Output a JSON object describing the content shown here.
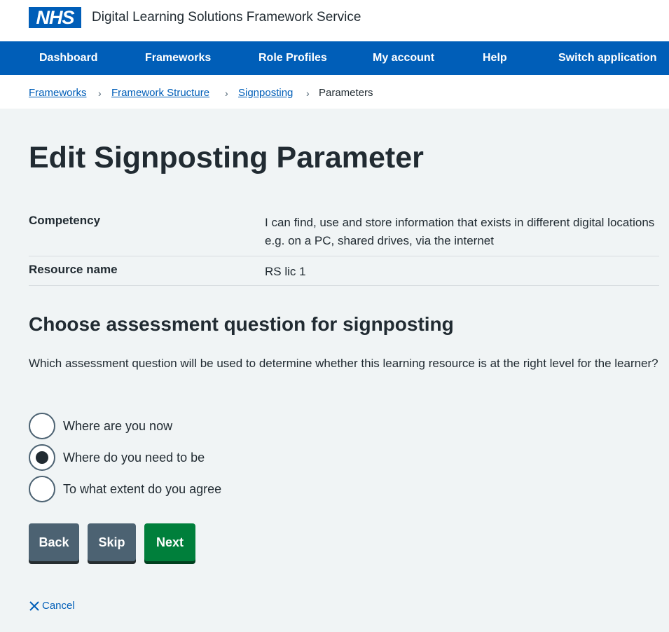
{
  "header": {
    "logo_text": "NHS",
    "service_name": "Digital Learning Solutions Framework Service"
  },
  "nav": {
    "items": [
      "Dashboard",
      "Frameworks",
      "Role Profiles",
      "My account",
      "Help",
      "Switch application"
    ]
  },
  "breadcrumb": {
    "links": [
      "Frameworks",
      "Framework Structure",
      "Signposting"
    ],
    "current": "Parameters"
  },
  "page": {
    "title": "Edit Signposting Parameter"
  },
  "summary": {
    "rows": [
      {
        "key": "Competency",
        "value": "I can find, use and store information that exists in different digital locations e.g. on a PC, shared drives, via the internet"
      },
      {
        "key": "Resource name",
        "value": "RS lic 1"
      }
    ]
  },
  "assessment": {
    "heading": "Choose assessment question for signposting",
    "question": "Which assessment question will be used to determine whether this learning resource is at the right level for the learner?",
    "options": [
      "Where are you now",
      "Where do you need to be",
      "To what extent do you agree"
    ],
    "selected": "Where do you need to be"
  },
  "actions": {
    "back": "Back",
    "skip": "Skip",
    "next": "Next",
    "cancel": "Cancel"
  },
  "colors": {
    "nhs_blue": "#005eb8",
    "green": "#007f3b",
    "secondary_grey": "#4c6272",
    "background": "#f0f4f5"
  }
}
